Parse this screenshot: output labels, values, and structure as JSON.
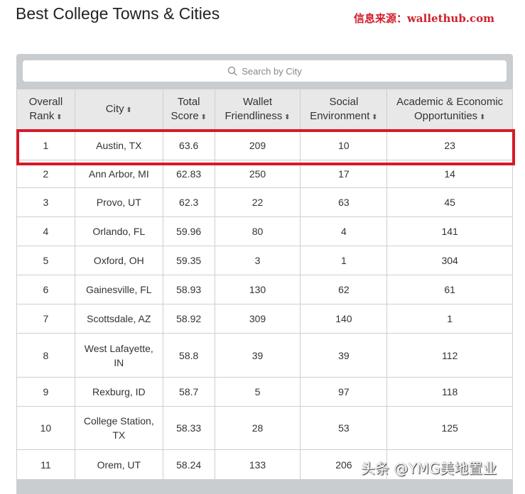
{
  "title": "Best College Towns & Cities",
  "source": "信息来源：wallethub.com",
  "search": {
    "placeholder": "Search by City"
  },
  "headers": [
    [
      "Overall",
      "Rank"
    ],
    [
      "City",
      ""
    ],
    [
      "Total",
      "Score"
    ],
    [
      "Wallet",
      "Friendliness"
    ],
    [
      "Social",
      "Environment"
    ],
    [
      "Academic & Economic",
      "Opportunities"
    ]
  ],
  "rows": [
    [
      "1",
      "Austin, TX",
      "63.6",
      "209",
      "10",
      "23"
    ],
    [
      "2",
      "Ann Arbor, MI",
      "62.83",
      "250",
      "17",
      "14"
    ],
    [
      "3",
      "Provo, UT",
      "62.3",
      "22",
      "63",
      "45"
    ],
    [
      "4",
      "Orlando, FL",
      "59.96",
      "80",
      "4",
      "141"
    ],
    [
      "5",
      "Oxford, OH",
      "59.35",
      "3",
      "1",
      "304"
    ],
    [
      "6",
      "Gainesville, FL",
      "58.93",
      "130",
      "62",
      "61"
    ],
    [
      "7",
      "Scottsdale, AZ",
      "58.92",
      "309",
      "140",
      "1"
    ],
    [
      "8",
      "West Lafayette, IN",
      "58.8",
      "39",
      "39",
      "112"
    ],
    [
      "9",
      "Rexburg, ID",
      "58.7",
      "5",
      "97",
      "118"
    ],
    [
      "10",
      "College Station, TX",
      "58.33",
      "28",
      "53",
      "125"
    ],
    [
      "11",
      "Orem, UT",
      "58.24",
      "133",
      "206",
      ""
    ]
  ],
  "watermark": "头条 @YMG美地置业"
}
